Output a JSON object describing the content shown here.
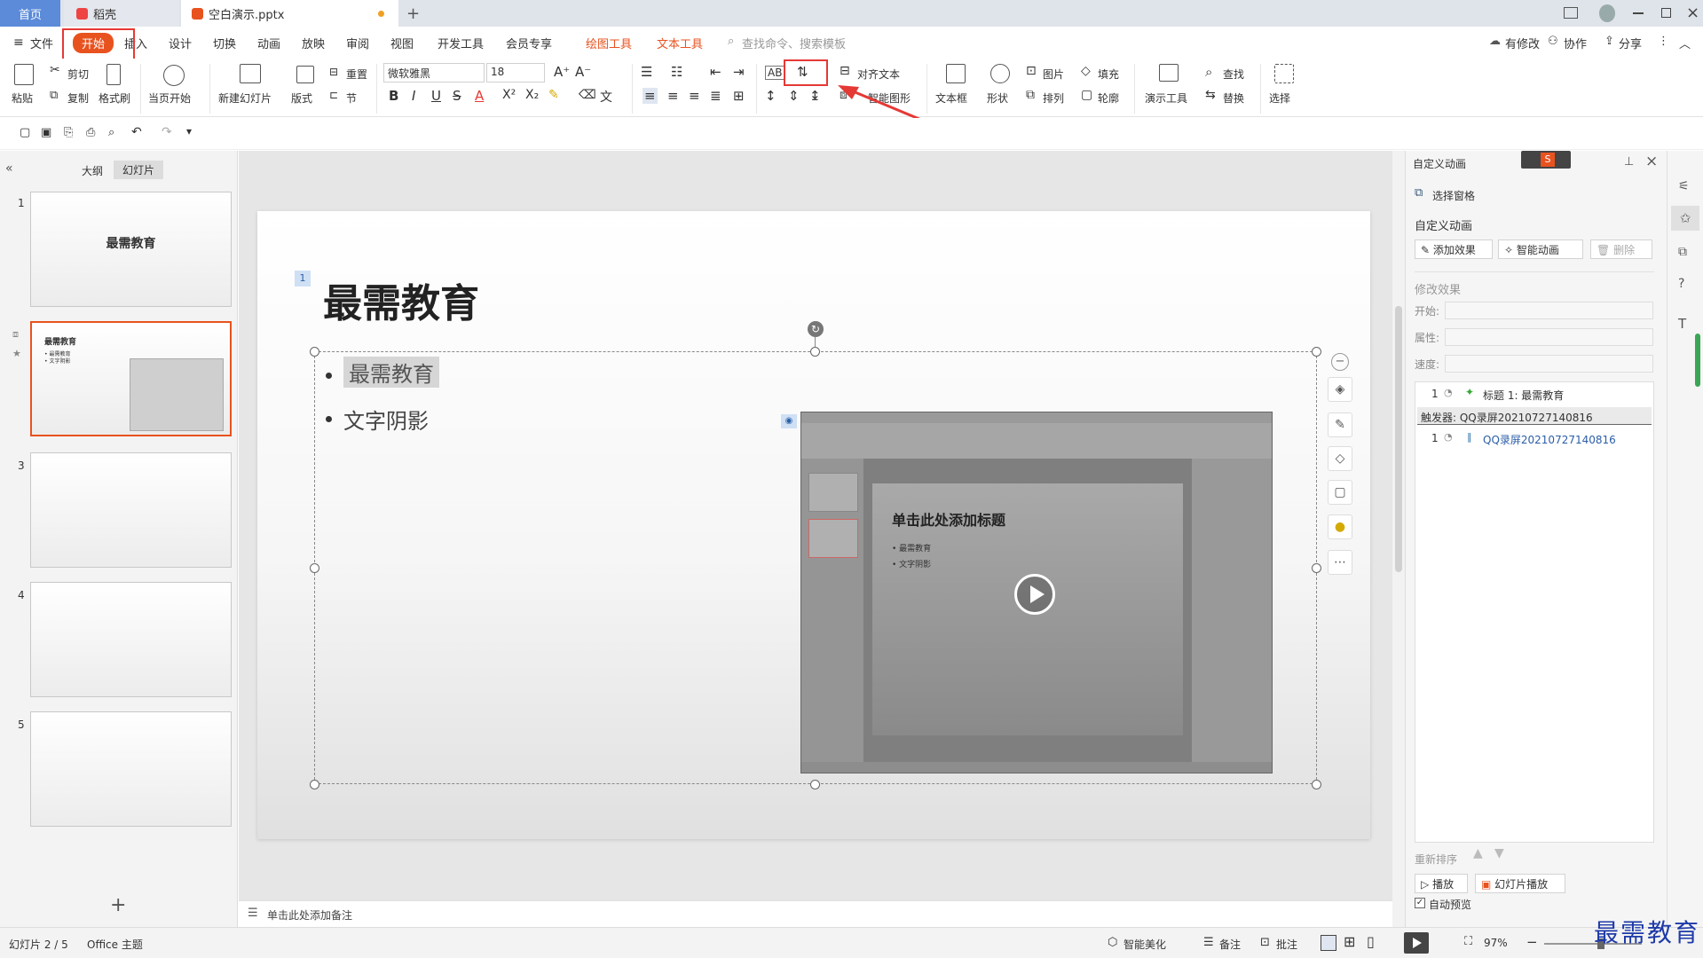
{
  "tabs": {
    "home": "首页",
    "daoke": "稻壳",
    "doc": "空白演示.pptx",
    "add": "+"
  },
  "menu": {
    "file": "文件",
    "start": "开始",
    "insert": "插入",
    "design": "设计",
    "transition": "切换",
    "animation": "动画",
    "slideshow": "放映",
    "review": "审阅",
    "view": "视图",
    "devtools": "开发工具",
    "member": "会员专享",
    "drawtools": "绘图工具",
    "texttools": "文本工具",
    "search_placeholder": "查找命令、搜索模板",
    "modified": "有修改",
    "collab": "协作",
    "share": "分享"
  },
  "ribbon": {
    "paste": "粘贴",
    "cut": "剪切",
    "copy": "复制",
    "format_painter": "格式刷",
    "from_current": "当页开始",
    "new_slide": "新建幻灯片",
    "layout": "版式",
    "reset": "重置",
    "section": "节",
    "font_name": "微软雅黑",
    "font_size": "18",
    "align_text": "对齐文本",
    "smart_shape": "智能图形",
    "textbox": "文本框",
    "shape": "形状",
    "picture": "图片",
    "arrange": "排列",
    "fill": "填充",
    "outline": "轮廓",
    "present_tools": "演示工具",
    "find": "查找",
    "replace": "替换",
    "select": "选择",
    "bold": "B",
    "italic": "I",
    "underline": "U",
    "strike": "S",
    "fontcolor": "A"
  },
  "leftpane": {
    "outline": "大纲",
    "slides": "幻灯片",
    "add": "+",
    "thumbs": [
      {
        "num": "1",
        "title": "最需教育"
      },
      {
        "num": "2",
        "title": "最需教育",
        "b1": "• 最需教育",
        "b2": "• 文字阴影"
      },
      {
        "num": "3"
      },
      {
        "num": "4"
      },
      {
        "num": "5"
      }
    ]
  },
  "slide": {
    "badge": "1",
    "title": "最需教育",
    "bullet1": "最需教育",
    "bullet2": "文字阴影",
    "video": {
      "title": "单击此处添加标题",
      "b1": "• 最需教育",
      "b2": "• 文字阴影"
    }
  },
  "notes": {
    "placeholder": "单击此处添加备注"
  },
  "rightpane": {
    "header": "自定义动画",
    "select_pane": "选择窗格",
    "section_title": "自定义动画",
    "add_effect": "添加效果",
    "smart_anim": "智能动画",
    "delete": "删除",
    "modify": "修改效果",
    "start": "开始:",
    "property": "属性:",
    "speed": "速度:",
    "items": [
      {
        "num": "1",
        "label": "标题 1: 最需教育"
      },
      {
        "trigger": "触发器: QQ录屏20210727140816"
      },
      {
        "num": "1",
        "label": "QQ录屏20210727140816"
      }
    ],
    "reorder": "重新排序",
    "play": "播放",
    "slideshow": "幻灯片播放",
    "autopreview": "自动预览"
  },
  "status": {
    "slide_info": "幻灯片 2 / 5",
    "theme": "Office 主题",
    "beautify": "智能美化",
    "notes": "备注",
    "comment": "批注",
    "zoom": "97%"
  },
  "watermark": "最需教育",
  "colors": {
    "accent": "#e8521f",
    "highlight_red": "#e53935",
    "tab_active": "#5b8bd9"
  }
}
